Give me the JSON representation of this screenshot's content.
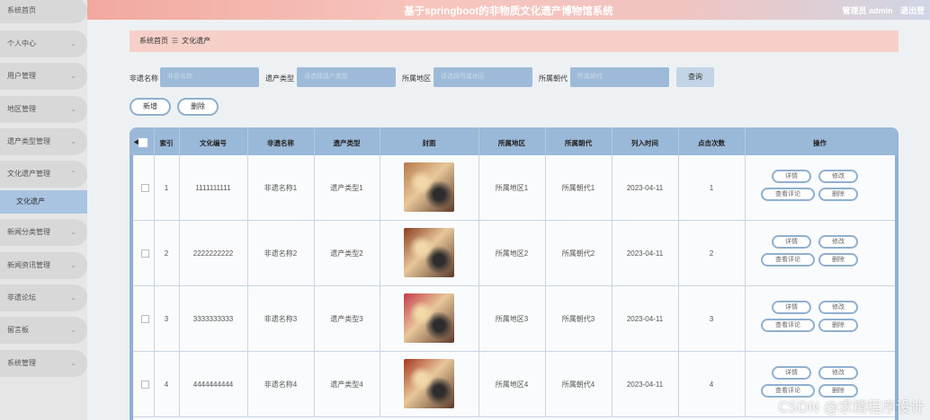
{
  "header": {
    "title": "基于springboot的非物质文化遗产博物馆系统",
    "user": "管理员 admin",
    "logout": "退出登"
  },
  "sidebar": {
    "items": [
      {
        "label": "系统首页",
        "has_chevron": false
      },
      {
        "label": "个人中心",
        "has_chevron": true
      },
      {
        "label": "用户管理",
        "has_chevron": true
      },
      {
        "label": "地区管理",
        "has_chevron": true
      },
      {
        "label": "遗产类型管理",
        "has_chevron": true
      },
      {
        "label": "文化遗产管理",
        "has_chevron": true
      },
      {
        "label": "新闻分类管理",
        "has_chevron": true
      },
      {
        "label": "新闻资讯管理",
        "has_chevron": true
      },
      {
        "label": "非遗论坛",
        "has_chevron": true
      },
      {
        "label": "留言板",
        "has_chevron": true
      },
      {
        "label": "系统管理",
        "has_chevron": true
      }
    ],
    "active_sub": "文化遗产"
  },
  "breadcrumb": {
    "home": "系统首页",
    "sep": "☰",
    "current": "文化遗产"
  },
  "search": {
    "name_label": "非遗名称",
    "name_placeholder": "非遗名称",
    "type_label": "遗产类型",
    "type_placeholder": "请选择遗产类型",
    "region_label": "所属地区",
    "region_placeholder": "请选择所属地区",
    "dynasty_label": "所属朝代",
    "dynasty_placeholder": "所属朝代",
    "button": "查询"
  },
  "actions": {
    "add": "新增",
    "delete": "删除"
  },
  "table": {
    "columns": [
      "索引",
      "文化编号",
      "非遗名称",
      "遗产类型",
      "封面",
      "所属地区",
      "所属朝代",
      "列入时间",
      "点击次数",
      "操作"
    ],
    "ops": {
      "detail": "详情",
      "edit": "修改",
      "comments": "查看评论",
      "delete": "删除"
    },
    "rows": [
      {
        "index": "1",
        "code": "1111111111",
        "name": "非遗名称1",
        "type": "遗产类型1",
        "region": "所属地区1",
        "dynasty": "所属朝代1",
        "date": "2023-04-11",
        "clicks": "1",
        "cover_color": "#b57a4c"
      },
      {
        "index": "2",
        "code": "2222222222",
        "name": "非遗名称2",
        "type": "遗产类型2",
        "region": "所属地区2",
        "dynasty": "所属朝代2",
        "date": "2023-04-11",
        "clicks": "2",
        "cover_color": "#8a3c1e"
      },
      {
        "index": "3",
        "code": "3333333333",
        "name": "非遗名称3",
        "type": "遗产类型3",
        "region": "所属地区3",
        "dynasty": "所属朝代3",
        "date": "2023-04-11",
        "clicks": "3",
        "cover_color": "#c43a4a"
      },
      {
        "index": "4",
        "code": "4444444444",
        "name": "非遗名称4",
        "type": "遗产类型4",
        "region": "所属地区4",
        "dynasty": "所属朝代4",
        "date": "2023-04-11",
        "clicks": "4",
        "cover_color": "#a53520"
      }
    ]
  },
  "watermark": "CSDN @求精程序设计"
}
